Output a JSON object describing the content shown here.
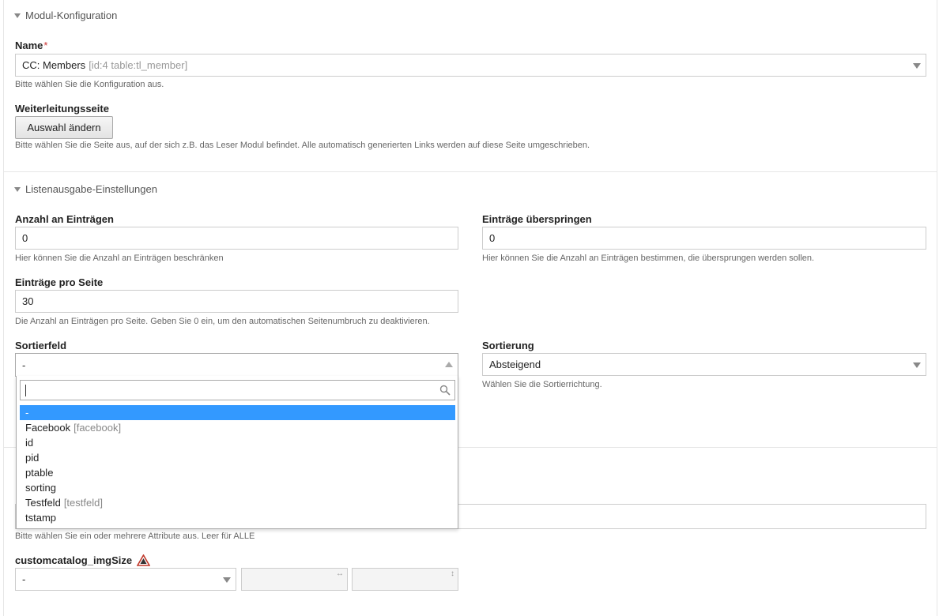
{
  "sections": {
    "modul_konfiguration": "Modul-Konfiguration",
    "listenausgabe": "Listenausgabe-Einstellungen"
  },
  "name_field": {
    "label": "Name",
    "required_mark": "*",
    "value": "CC: Members",
    "value_meta": "[id:4 table:tl_member]",
    "help": "Bitte wählen Sie die Konfiguration aus."
  },
  "weiterleitung": {
    "label": "Weiterleitungsseite",
    "button": "Auswahl ändern",
    "help": "Bitte wählen Sie die Seite aus, auf der sich z.B. das Leser Modul befindet. Alle automatisch generierten Links werden auf diese Seite umgeschrieben."
  },
  "anzahl": {
    "label": "Anzahl an Einträgen",
    "value": "0",
    "help": "Hier können Sie die Anzahl an Einträgen beschränken"
  },
  "ueberspringen": {
    "label": "Einträge überspringen",
    "value": "0",
    "help": "Hier können Sie die Anzahl an Einträgen bestimmen, die übersprungen werden sollen."
  },
  "pro_seite": {
    "label": "Einträge pro Seite",
    "value": "30",
    "help": "Die Anzahl an Einträgen pro Seite. Geben Sie 0 ein, um den automatischen Seitenumbruch zu deaktivieren."
  },
  "sortierfeld": {
    "label": "Sortierfeld",
    "value": "-",
    "search_value": "",
    "options": [
      {
        "label": "-",
        "meta": "",
        "active": true
      },
      {
        "label": "Facebook",
        "meta": "[facebook]",
        "active": false
      },
      {
        "label": "id",
        "meta": "",
        "active": false
      },
      {
        "label": "pid",
        "meta": "",
        "active": false
      },
      {
        "label": "ptable",
        "meta": "",
        "active": false
      },
      {
        "label": "sorting",
        "meta": "",
        "active": false
      },
      {
        "label": "Testfeld",
        "meta": "[testfeld]",
        "active": false
      },
      {
        "label": "tstamp",
        "meta": "",
        "active": false
      }
    ]
  },
  "sortierung": {
    "label": "Sortierung",
    "value": "Absteigend",
    "help": "Wählen Sie die Sortierrichtung."
  },
  "attribute": {
    "help": "Bitte wählen Sie ein oder mehrere Attribute aus. Leer für ALLE"
  },
  "imgsize": {
    "label": "customcatalog_imgSize",
    "value": "-",
    "width_glyph": "↔",
    "height_glyph": "↕"
  },
  "colors": {
    "accent": "#3399ff",
    "required": "#cc3333",
    "warning": "#c0392b"
  }
}
